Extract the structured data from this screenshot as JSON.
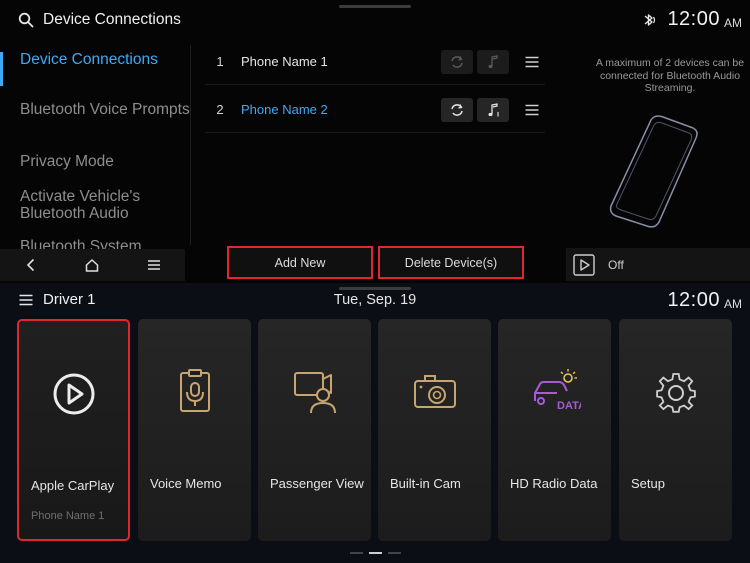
{
  "top": {
    "title": "Device Connections",
    "time": "12:00",
    "ampm": "AM",
    "menu": [
      "Device Connections",
      "Bluetooth Voice Prompts",
      "Privacy Mode",
      "Activate Vehicle's Bluetooth Audio",
      "Bluetooth System"
    ],
    "devices": [
      {
        "num": "1",
        "name": "Phone Name 1",
        "connected": false
      },
      {
        "num": "2",
        "name": "Phone Name 2",
        "connected": true
      }
    ],
    "info": "A maximum of 2 devices can be connected for Bluetooth Audio Streaming.",
    "add_new": "Add New",
    "delete_devices": "Delete Device(s)",
    "audio_state": "Off"
  },
  "bottom": {
    "profile": "Driver 1",
    "date": "Tue, Sep. 19",
    "time": "12:00",
    "ampm": "AM",
    "tiles": [
      {
        "label": "Apple CarPlay",
        "sub": "Phone Name 1",
        "icon": "carplay-icon"
      },
      {
        "label": "Voice Memo",
        "sub": "",
        "icon": "voice-memo-icon"
      },
      {
        "label": "Passenger View",
        "sub": "",
        "icon": "passenger-view-icon"
      },
      {
        "label": "Built-in Cam",
        "sub": "",
        "icon": "camera-icon"
      },
      {
        "label": "HD Radio Data",
        "sub": "",
        "icon": "hd-radio-data-icon",
        "icon_text": "DATA"
      },
      {
        "label": "Setup",
        "sub": "",
        "icon": "gear-icon"
      }
    ]
  },
  "colors": {
    "accent": "#3fa9f5",
    "highlight": "#e0262f",
    "icon_gold": "#c8a46e",
    "icon_purple": "#a65bd8",
    "icon_yellow": "#e8c95a"
  }
}
